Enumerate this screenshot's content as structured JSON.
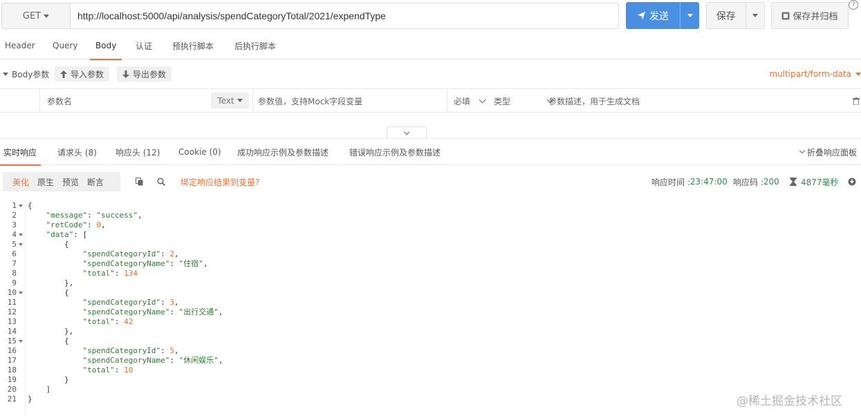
{
  "request": {
    "method": "GET",
    "url": "http://localhost:5000/api/analysis/spendCategoryTotal/2021/expendType",
    "send_label": "发送",
    "save_label": "保存",
    "archive_label": "保存并归档",
    "help_glyph": "?"
  },
  "req_tabs": [
    "Header",
    "Query",
    "Body",
    "认证",
    "预执行脚本",
    "后执行脚本"
  ],
  "body_bar": {
    "toggle_label": "Body参数",
    "import_label": "导入参数",
    "export_label": "导出参数",
    "form_type": "multipart/form-data"
  },
  "param_row": {
    "name_placeholder": "参数名",
    "type_label": "Text",
    "value_placeholder": "参数值，支持Mock字段变量",
    "required_label": "必填",
    "kind_label": "类型",
    "desc_placeholder": "参数描述，用于生成文档"
  },
  "resp_tabs": {
    "live": "实时响应",
    "req_headers": "请求头 (8)",
    "resp_headers": "响应头 (12)",
    "cookie": "Cookie (0)",
    "success_example": "成功响应示例及参数描述",
    "error_example": "错误响应示例及参数描述",
    "fold_label": "折叠响应面板"
  },
  "resp_bar": {
    "views": [
      "美化",
      "原生",
      "预览",
      "断言"
    ],
    "bind_label": "绑定响应结果到变量?",
    "time_label": "响应时间 : ",
    "time_value": "23:47:00",
    "code_label": "响应码 : ",
    "code_value": "200",
    "duration": "4877毫秒"
  },
  "response_body": {
    "message": "success",
    "retCode": 0,
    "data": [
      {
        "spendCategoryId": 2,
        "spendCategoryName": "住宿",
        "total": 134
      },
      {
        "spendCategoryId": 3,
        "spendCategoryName": "出行交通",
        "total": 42
      },
      {
        "spendCategoryId": 5,
        "spendCategoryName": "休闲娱乐",
        "total": 10
      }
    ]
  },
  "watermark": "@稀土掘金技术社区",
  "colors": {
    "accent": "#e8743b",
    "primary": "#4a90e2",
    "json_key": "#2e7d32",
    "json_number": "#e8743b"
  }
}
